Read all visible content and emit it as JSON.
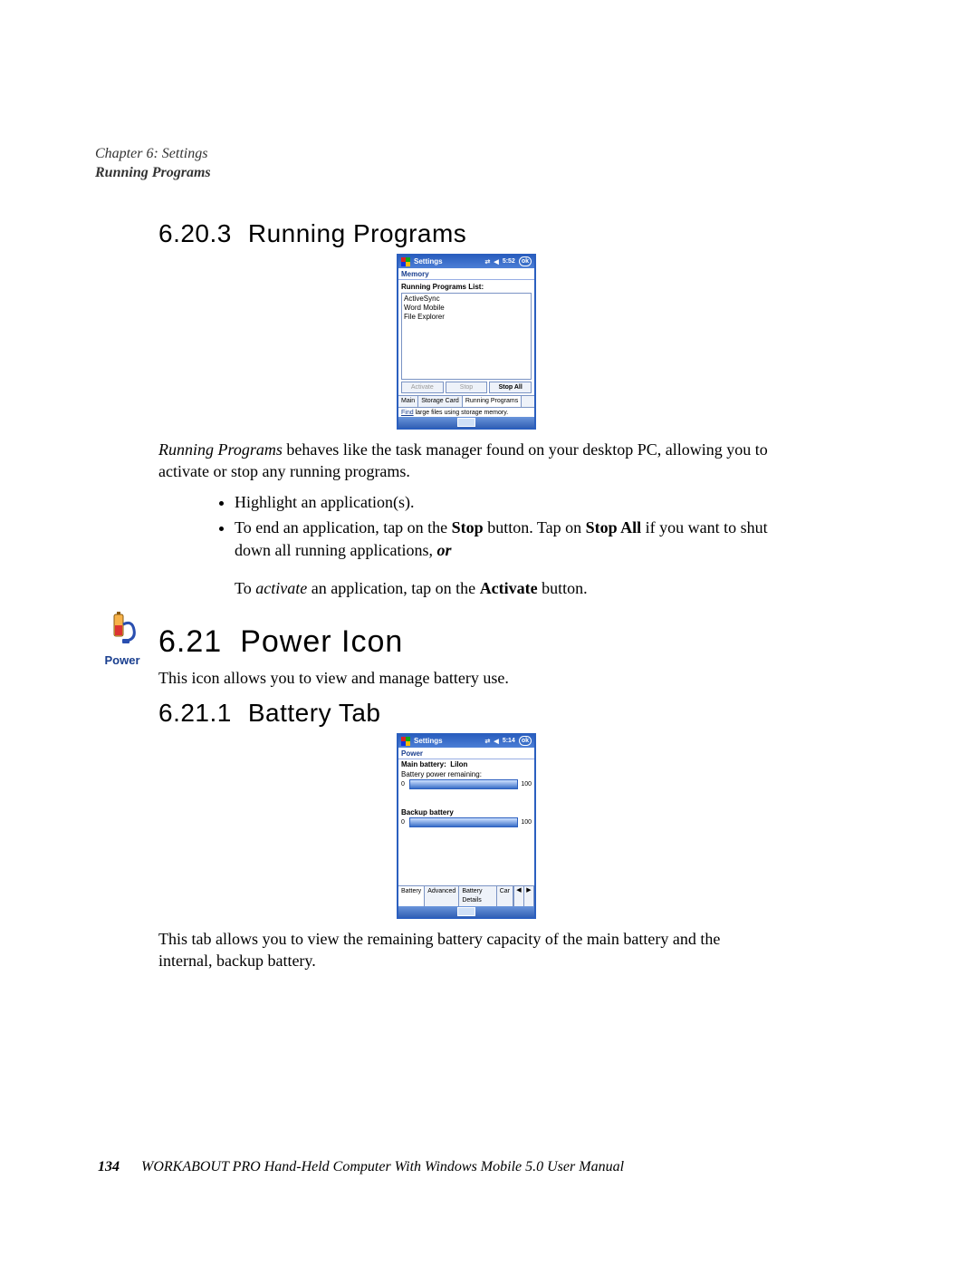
{
  "header": {
    "chapter": "Chapter 6: Settings",
    "subsection": "Running Programs"
  },
  "section_6_20_3": {
    "number": "6.20.3",
    "title": "Running Programs",
    "paragraph_parts": {
      "p1a": "Running Programs",
      "p1b": " behaves like the task manager found on your desktop PC, allowing you to activate or stop any running programs."
    },
    "bullets": {
      "b1": "Highlight an application(s).",
      "b2a": "To end an application, tap on the ",
      "b2_stop": "Stop",
      "b2b": " button. Tap on ",
      "b2_stopall": "Stop All",
      "b2c": " if you want to shut down all running applications, ",
      "b2_or": "or",
      "b3a": "To ",
      "b3_act": "activate",
      "b3b": " an application, tap on the ",
      "b3_btn": "Activate",
      "b3c": " button."
    },
    "wm": {
      "title": "Settings",
      "time": "5:52",
      "ok": "ok",
      "subhead": "Memory",
      "list_label": "Running Programs List:",
      "programs": [
        "ActiveSync",
        "Word Mobile",
        "File Explorer"
      ],
      "buttons": {
        "activate": "Activate",
        "stop": "Stop",
        "stop_all": "Stop All"
      },
      "tabs": [
        "Main",
        "Storage Card",
        "Running Programs"
      ],
      "active_tab": 2,
      "bottom": {
        "link": "Find",
        "rest": " large files using storage memory."
      }
    }
  },
  "section_6_21": {
    "number": "6.21",
    "title": "Power Icon",
    "icon_label": "Power",
    "paragraph": "This icon allows you to view and manage battery use."
  },
  "section_6_21_1": {
    "number": "6.21.1",
    "title": "Battery Tab",
    "paragraph": "This tab allows you to view the remaining battery capacity of the main battery and the internal, backup battery.",
    "wm": {
      "title": "Settings",
      "time": "5:14",
      "ok": "ok",
      "subhead": "Power",
      "main_battery_label": "Main battery:",
      "main_battery_type": "LiIon",
      "remaining_label": "Battery power remaining:",
      "main_zero": "0",
      "main_value": "100",
      "backup_label": "Backup battery",
      "backup_zero": "0",
      "backup_value": "100",
      "tabs": [
        "Battery",
        "Advanced",
        "Battery Details",
        "Car"
      ],
      "active_tab": 0
    }
  },
  "footer": {
    "page": "134",
    "text": "WORKABOUT PRO Hand-Held Computer With Windows Mobile 5.0 User Manual"
  }
}
